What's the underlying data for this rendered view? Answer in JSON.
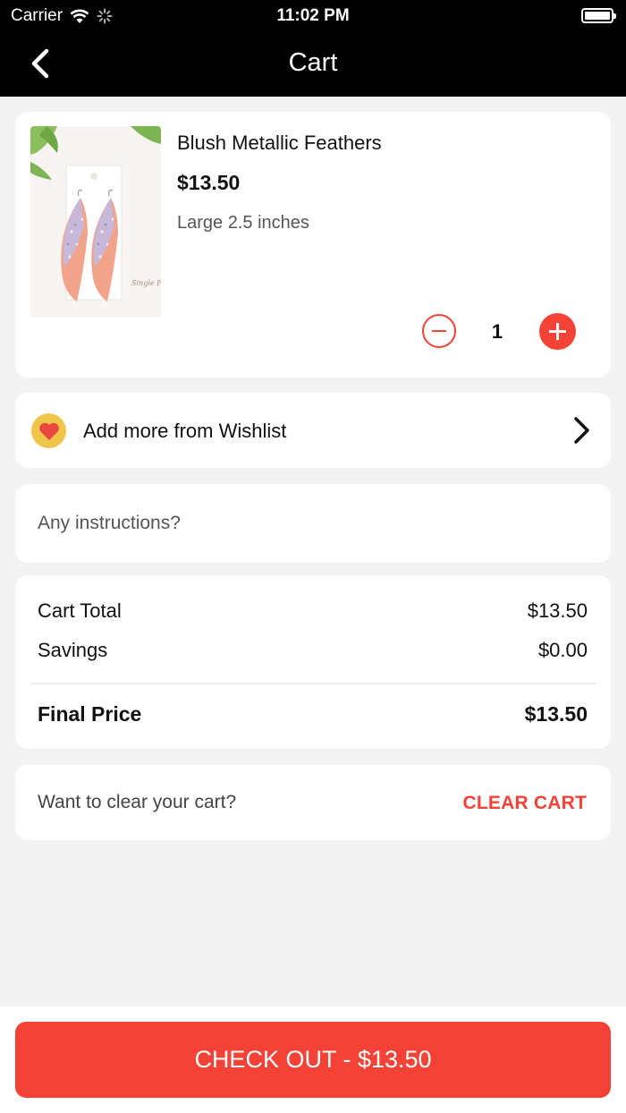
{
  "status_bar": {
    "carrier": "Carrier",
    "time": "11:02 PM",
    "battery_level": 1.0
  },
  "header": {
    "title": "Cart",
    "back_icon": "chevron-left-icon"
  },
  "cart_item": {
    "name": "Blush Metallic Feathers",
    "price": "$13.50",
    "variant": "Large 2.5 inches",
    "quantity": "1",
    "image_label": "Single F"
  },
  "wishlist": {
    "label": "Add more from Wishlist",
    "icon": "heart-icon"
  },
  "instructions": {
    "placeholder": "Any instructions?",
    "value": ""
  },
  "totals": {
    "cart_total_label": "Cart Total",
    "cart_total_value": "$13.50",
    "savings_label": "Savings",
    "savings_value": "$0.00",
    "final_label": "Final Price",
    "final_value": "$13.50"
  },
  "clear": {
    "prompt": "Want to clear your cart?",
    "button_label": "CLEAR CART"
  },
  "checkout": {
    "label": "CHECK OUT - $13.50"
  },
  "colors": {
    "accent": "#f44336",
    "header_bg": "#000000",
    "page_bg": "#f3f3f3"
  }
}
